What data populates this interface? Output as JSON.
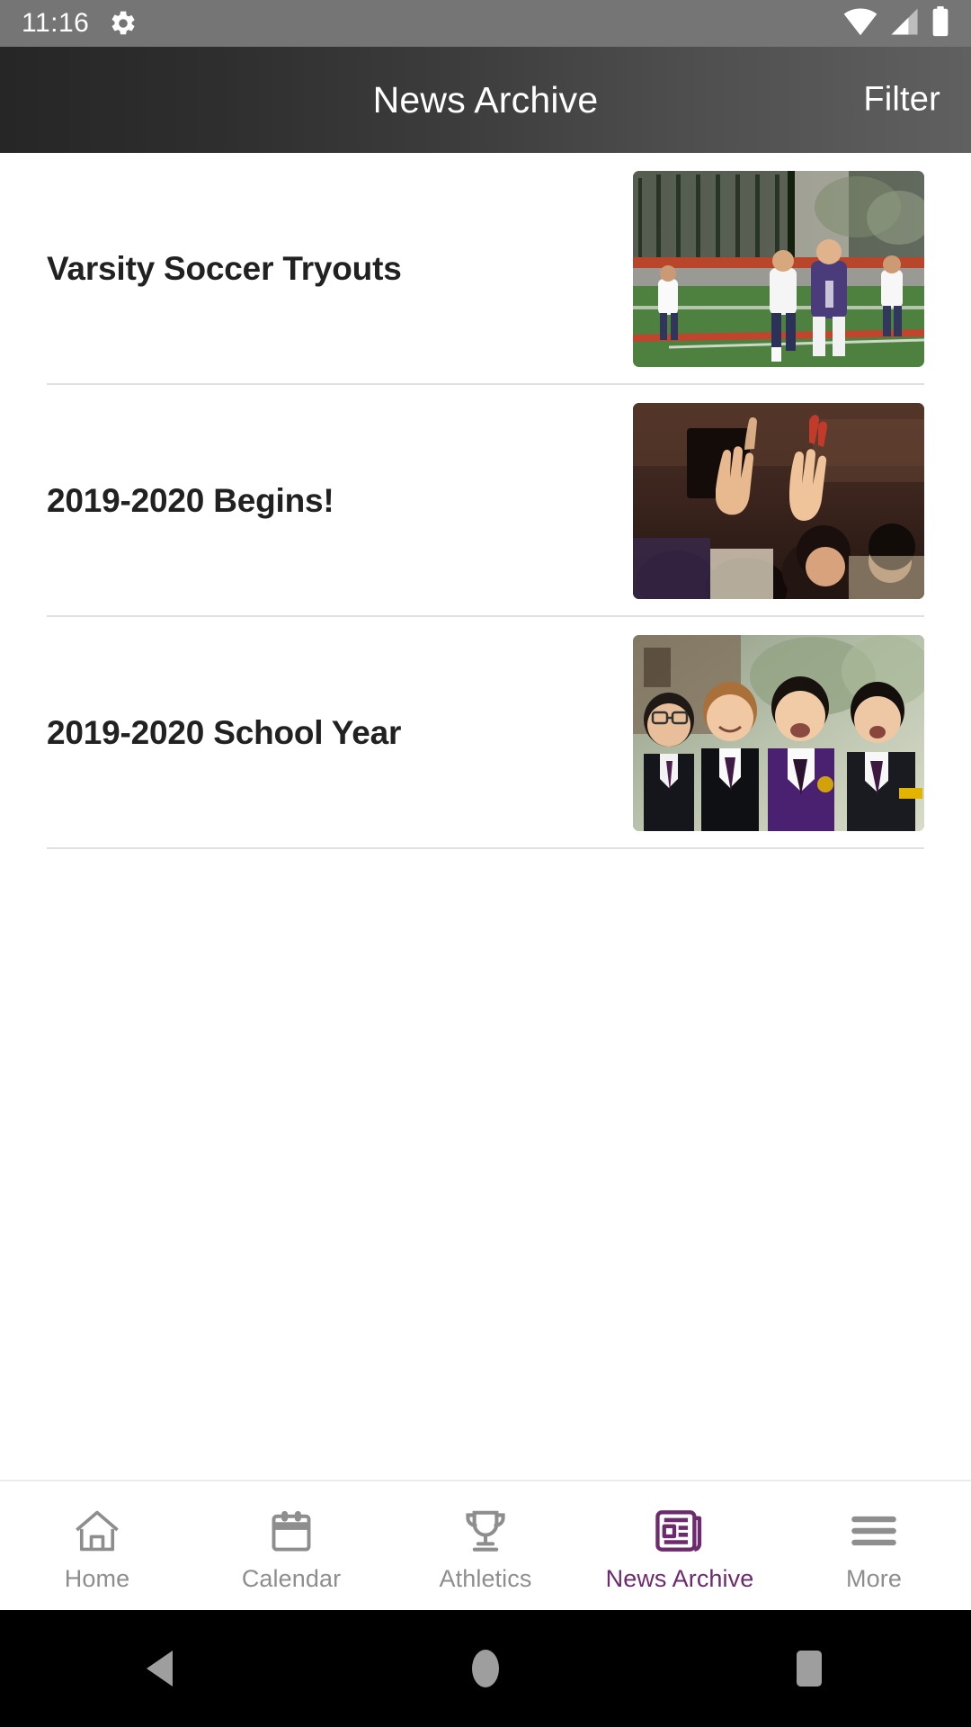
{
  "status_bar": {
    "time": "11:16",
    "icons": [
      "gear-icon",
      "wifi-icon",
      "cellular-signal-icon",
      "battery-icon"
    ]
  },
  "header": {
    "title": "News Archive",
    "action_label": "Filter"
  },
  "news_items": [
    {
      "title": "Varsity Soccer Tryouts",
      "thumbnail": "soccer-field-players-photo"
    },
    {
      "title": "2019-2020 Begins!",
      "thumbnail": "students-cheering-hands-raised-photo"
    },
    {
      "title": "2019-2020 School Year",
      "thumbnail": "schoolchildren-uniforms-photo"
    }
  ],
  "tab_bar": {
    "active_color": "#6d2b6d",
    "inactive_color": "#8e8e8e",
    "items": [
      {
        "label": "Home",
        "icon": "home-icon",
        "active": false
      },
      {
        "label": "Calendar",
        "icon": "calendar-icon",
        "active": false
      },
      {
        "label": "Athletics",
        "icon": "trophy-icon",
        "active": false
      },
      {
        "label": "News Archive",
        "icon": "newspaper-icon",
        "active": true
      },
      {
        "label": "More",
        "icon": "hamburger-menu-icon",
        "active": false
      }
    ]
  },
  "android_nav": {
    "buttons": [
      "back-icon",
      "home-icon",
      "recents-icon"
    ]
  }
}
